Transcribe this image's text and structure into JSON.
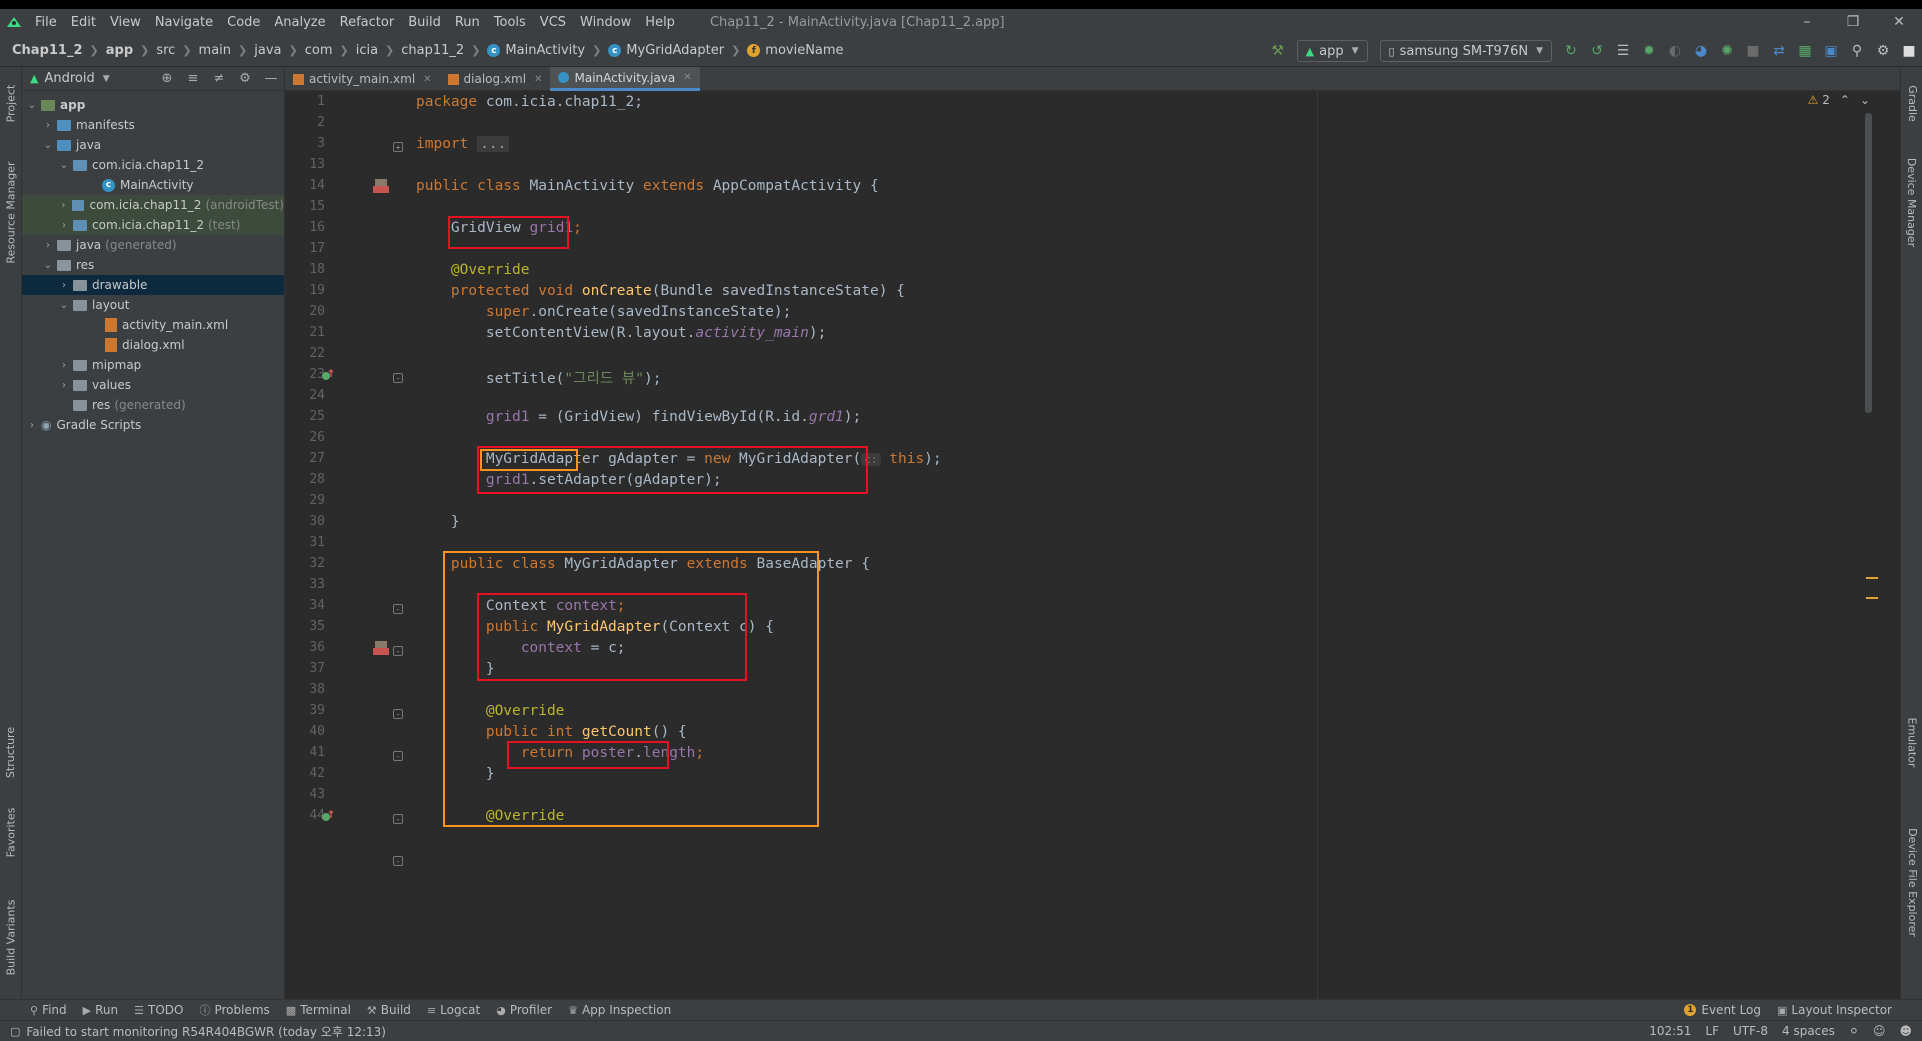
{
  "window": {
    "title": "Chap11_2 - MainActivity.java [Chap11_2.app]",
    "menu": [
      "File",
      "Edit",
      "View",
      "Navigate",
      "Code",
      "Analyze",
      "Refactor",
      "Build",
      "Run",
      "Tools",
      "VCS",
      "Window",
      "Help"
    ]
  },
  "breadcrumb": {
    "items": [
      "Chap11_2",
      "app",
      "src",
      "main",
      "java",
      "com",
      "icia",
      "chap11_2",
      "MainActivity",
      "MyGridAdapter",
      "movieName"
    ]
  },
  "toolbar": {
    "config": "app",
    "device": "samsung SM-T976N"
  },
  "left_strip": {
    "project": "Project",
    "resource_manager": "Resource Manager",
    "structure": "Structure",
    "favorites": "Favorites",
    "build_variants": "Build Variants"
  },
  "right_strip": {
    "gradle": "Gradle",
    "device_manager": "Device Manager",
    "emulator": "Emulator",
    "device_file_explorer": "Device File Explorer"
  },
  "project": {
    "view_mode": "Android",
    "tree": {
      "app": "app",
      "manifests": "manifests",
      "java": "java",
      "pkg_main": "com.icia.chap11_2",
      "main_activity": "MainActivity",
      "pkg_android_test": "com.icia.chap11_2",
      "android_test_tag": "(androidTest)",
      "pkg_test": "com.icia.chap11_2",
      "test_tag": "(test)",
      "java_generated": "java",
      "generated_tag": "(generated)",
      "res": "res",
      "drawable": "drawable",
      "layout": "layout",
      "activity_main": "activity_main.xml",
      "dialog": "dialog.xml",
      "mipmap": "mipmap",
      "values": "values",
      "res_generated": "res",
      "res_generated_tag": "(generated)",
      "gradle_scripts": "Gradle Scripts"
    }
  },
  "editor": {
    "tabs": [
      "activity_main.xml",
      "dialog.xml",
      "MainActivity.java"
    ],
    "warnings": "2",
    "line_numbers": [
      "1",
      "2",
      "3",
      "13",
      "14",
      "15",
      "16",
      "17",
      "18",
      "19",
      "20",
      "21",
      "22",
      "23",
      "24",
      "25",
      "26",
      "27",
      "28",
      "29",
      "30",
      "31",
      "32",
      "33",
      "34",
      "35",
      "36",
      "37",
      "38",
      "39",
      "40",
      "41",
      "42",
      "43",
      "44"
    ],
    "code": {
      "l1_kw": "package",
      "l1_rest": " com.icia.chap11_2;",
      "l3_kw": "import",
      "l3_fold": "...",
      "l14_kw1": "public class",
      "l14_name": " MainActivity ",
      "l14_kw2": "extends",
      "l14_rest": " AppCompatActivity {",
      "l16_type": "GridView ",
      "l16_field": "grid1",
      "l16_end": ";",
      "l18_ann": "@Override",
      "l19_kw": "protected void ",
      "l19_fn": "onCreate",
      "l19_rest": "(Bundle savedInstanceState) {",
      "l20_kw": "super",
      "l20_rest": ".onCreate(savedInstanceState);",
      "l21_a": "setContentView(R.layout.",
      "l21_it": "activity_main",
      "l21_b": ");",
      "l23_a": "setTitle(",
      "l23_str": "\"그리드 뷰\"",
      "l23_b": ");",
      "l25_field": "grid1",
      "l25_a": " = (GridView) findViewById(R.id.",
      "l25_it": "grd1",
      "l25_b": ");",
      "l27_type": "MyGridAdapter",
      "l27_a": " gAdapter = ",
      "l27_kw": "new",
      "l27_b": " MyGridAdapter(",
      "l27_hint": "c:",
      "l27_this": " this",
      "l27_c": ");",
      "l28_field": "grid1",
      "l28_a": ".setAdapter(gAdapter);",
      "l30": "}",
      "l32_kw1": "public class",
      "l32_name": " MyGridAdapter ",
      "l32_kw2": "extends",
      "l32_rest": " BaseAdapter {",
      "l34_type": "Context ",
      "l34_field": "context",
      "l34_end": ";",
      "l35_kw": "public ",
      "l35_fn": "MyGridAdapter",
      "l35_rest": "(Context c) {",
      "l36_field": "context",
      "l36_rest": " = c;",
      "l37": "}",
      "l39_ann": "@Override",
      "l40_kw": "public int ",
      "l40_fn": "getCount",
      "l40_rest": "() {",
      "l41_kw": "return ",
      "l41_field": "poster",
      "l41_a": ".",
      "l41_field2": "length",
      "l41_b": ";",
      "l42": "}",
      "l44_ann": "@Override"
    }
  },
  "tool_windows": {
    "left": [
      "Find",
      "Run",
      "TODO",
      "Problems",
      "Terminal",
      "Build",
      "Logcat",
      "Profiler",
      "App Inspection"
    ],
    "right": [
      "Event Log",
      "Layout Inspector"
    ],
    "event_count": "1"
  },
  "status_bar": {
    "message": "Failed to start monitoring R54R404BGWR (today 오후 12:13)",
    "position": "102:51",
    "line_sep": "LF",
    "encoding": "UTF-8",
    "indent": "4 spaces"
  },
  "colors": {
    "highlight_red": "#e81123",
    "highlight_orange": "#f7931e",
    "keyword": "#cc7832",
    "function": "#ffc66d",
    "annotation": "#bbb529",
    "string": "#6a8759",
    "field": "#9876aa"
  }
}
